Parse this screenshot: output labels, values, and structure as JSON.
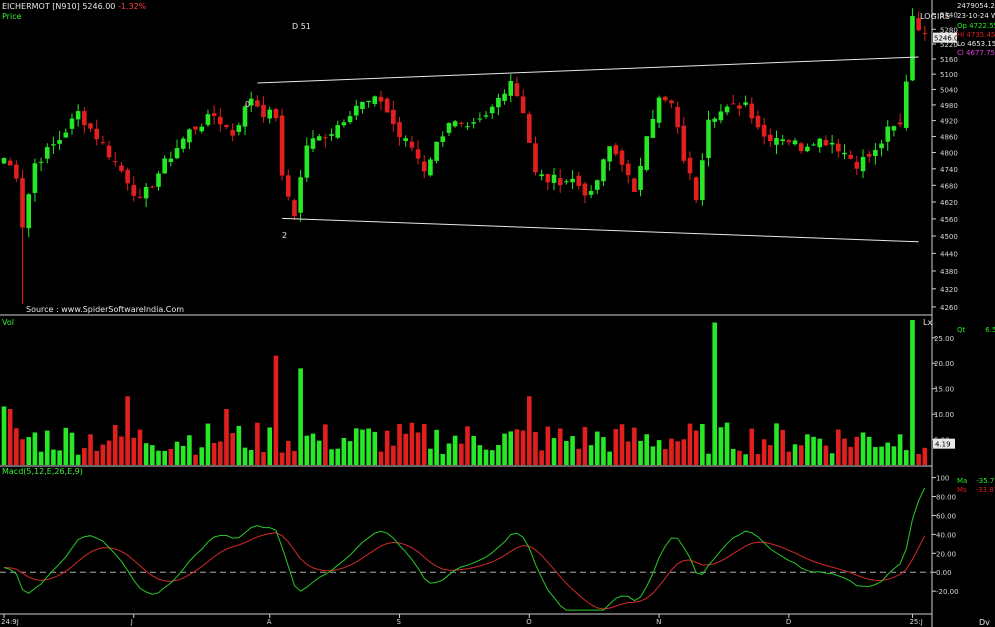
{
  "header": {
    "symbol": "EICHERMOT [N910]",
    "price": "5246.00",
    "change": "-1.32%",
    "price_label": "Price",
    "source": "Source : www.SpiderSoftwareIndia.Com",
    "study": "D 51",
    "log": "LOG",
    "irs": "IRS",
    "wave_0": "0",
    "wave_2": "2"
  },
  "right_panel": {
    "volume": "2479054.25",
    "date": "23-10-24 We",
    "open": "Op   4722.55",
    "high": "Hi   4735.45",
    "low": "Lo   4653.15",
    "close": "Cl   4677.75",
    "current_price": "5246.00",
    "vol_label": "Qt",
    "vol_value": "6.56",
    "vol_marker": "4.19",
    "macd_label": "Ma",
    "macd_value": "-35.72",
    "signal_label": "Ms",
    "signal_value": "-33.87"
  },
  "panels": {
    "vol_label": "Vol",
    "macd_label": "Macd(5,12,E,26,E,9)",
    "lx": "Lx",
    "dv": "Dv"
  },
  "colors": {
    "up": "#27e827",
    "down": "#e01f1f",
    "macd": "#29c829",
    "signal": "#d22a2a",
    "line": "#e8e8e8"
  },
  "chart_data": {
    "type": "candlestick",
    "price_axis": {
      "ticks": [
        4260,
        4320,
        4380,
        4440,
        4500,
        4560,
        4620,
        4680,
        4740,
        4800,
        4860,
        4920,
        4980,
        5040,
        5100,
        5160,
        5220,
        5280,
        5340
      ],
      "range": [
        4240,
        5380
      ],
      "scale": "log"
    },
    "x_axis": {
      "labels": [
        "24:9J",
        "J",
        "A",
        "S",
        "O",
        "N",
        "D",
        "25:J"
      ]
    },
    "volume_axis": {
      "ticks": [
        "5.00",
        "10.00",
        "15.00",
        "20.00",
        "25.00"
      ],
      "range": [
        0,
        28.5
      ]
    },
    "macd_axis": {
      "ticks": [
        "-20.00",
        "0.00",
        "20.00",
        "40.00",
        "60.00",
        "80.00",
        "100"
      ],
      "range": [
        -42,
        108
      ]
    },
    "trendlines": [
      {
        "from": [
          41,
          5065
        ],
        "to": [
          148,
          5168
        ]
      },
      {
        "from": [
          45,
          4562
        ],
        "to": [
          148,
          4480
        ]
      }
    ]
  }
}
